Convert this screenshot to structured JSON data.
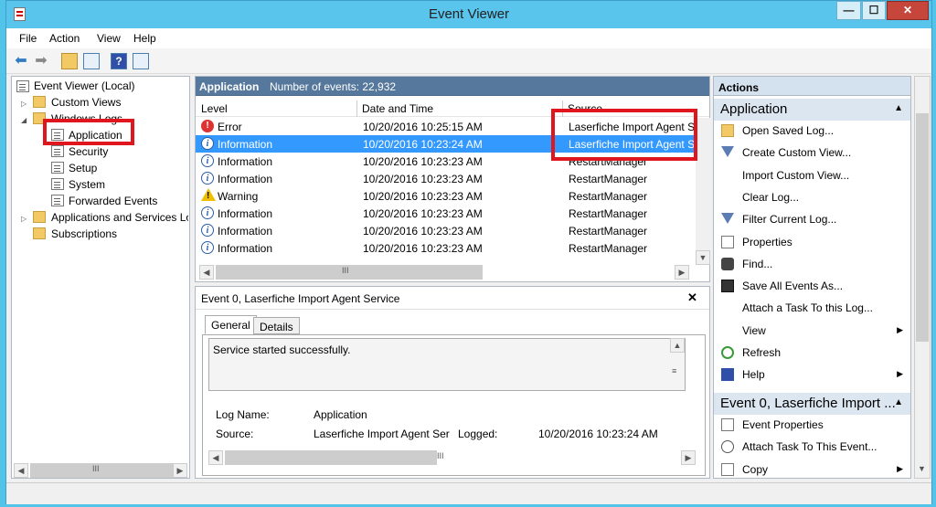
{
  "window": {
    "title": "Event Viewer",
    "min": "—",
    "max": "☐",
    "close": "✕"
  },
  "menu": [
    "File",
    "Action",
    "View",
    "Help"
  ],
  "tree": {
    "root": "Event Viewer (Local)",
    "custom_views": "Custom Views",
    "windows_logs": "Windows Logs",
    "logs": [
      "Application",
      "Security",
      "Setup",
      "System",
      "Forwarded Events"
    ],
    "apps_services": "Applications and Services Lo",
    "subscriptions": "Subscriptions"
  },
  "center": {
    "header_title": "Application",
    "header_count": "Number of events: 22,932",
    "columns": {
      "level": "Level",
      "datetime": "Date and Time",
      "source": "Source"
    },
    "events": [
      {
        "level": "Error",
        "icon": "error-icon",
        "datetime": "10/20/2016 10:25:15 AM",
        "source": "Laserfiche Import Agent S"
      },
      {
        "level": "Information",
        "icon": "info-icon",
        "datetime": "10/20/2016 10:23:24 AM",
        "source": "Laserfiche Import Agent S"
      },
      {
        "level": "Information",
        "icon": "info-icon",
        "datetime": "10/20/2016 10:23:23 AM",
        "source": "RestartManager"
      },
      {
        "level": "Information",
        "icon": "info-icon",
        "datetime": "10/20/2016 10:23:23 AM",
        "source": "RestartManager"
      },
      {
        "level": "Warning",
        "icon": "warning-icon",
        "datetime": "10/20/2016 10:23:23 AM",
        "source": "RestartManager"
      },
      {
        "level": "Information",
        "icon": "info-icon",
        "datetime": "10/20/2016 10:23:23 AM",
        "source": "RestartManager"
      },
      {
        "level": "Information",
        "icon": "info-icon",
        "datetime": "10/20/2016 10:23:23 AM",
        "source": "RestartManager"
      },
      {
        "level": "Information",
        "icon": "info-icon",
        "datetime": "10/20/2016 10:23:23 AM",
        "source": "RestartManager"
      }
    ],
    "scroll_grip": "III"
  },
  "detail": {
    "title": "Event 0, Laserfiche Import Agent Service",
    "close": "✕",
    "tabs": [
      "General",
      "Details"
    ],
    "message": "Service started successfully.",
    "log_name_label": "Log Name:",
    "log_name": "Application",
    "source_label": "Source:",
    "source": "Laserfiche Import Agent Ser",
    "logged_label": "Logged:",
    "logged": "10/20/2016 10:23:24 AM",
    "scroll_grip": "III"
  },
  "actions": {
    "header": "Actions",
    "section1": "Application",
    "items1": [
      {
        "label": "Open Saved Log...",
        "icon": "folder-open-icon",
        "submenu": false
      },
      {
        "label": "Create Custom View...",
        "icon": "filter-icon",
        "submenu": false
      },
      {
        "label": "Import Custom View...",
        "icon": "",
        "submenu": false
      },
      {
        "label": "Clear Log...",
        "icon": "",
        "submenu": false
      },
      {
        "label": "Filter Current Log...",
        "icon": "filter-icon",
        "submenu": false
      },
      {
        "label": "Properties",
        "icon": "properties-icon",
        "submenu": false
      },
      {
        "label": "Find...",
        "icon": "binoculars-icon",
        "submenu": false
      },
      {
        "label": "Save All Events As...",
        "icon": "save-icon",
        "submenu": false
      },
      {
        "label": "Attach a Task To this Log...",
        "icon": "",
        "submenu": false
      },
      {
        "label": "View",
        "icon": "",
        "submenu": true
      },
      {
        "label": "Refresh",
        "icon": "refresh-icon",
        "submenu": false
      },
      {
        "label": "Help",
        "icon": "help-icon",
        "submenu": true
      }
    ],
    "section2": "Event 0, Laserfiche Import ...",
    "items2": [
      {
        "label": "Event Properties",
        "icon": "properties-icon",
        "submenu": false
      },
      {
        "label": "Attach Task To This Event...",
        "icon": "task-icon",
        "submenu": false
      },
      {
        "label": "Copy",
        "icon": "copy-icon",
        "submenu": true
      }
    ]
  },
  "left_scroll_grip": "III"
}
